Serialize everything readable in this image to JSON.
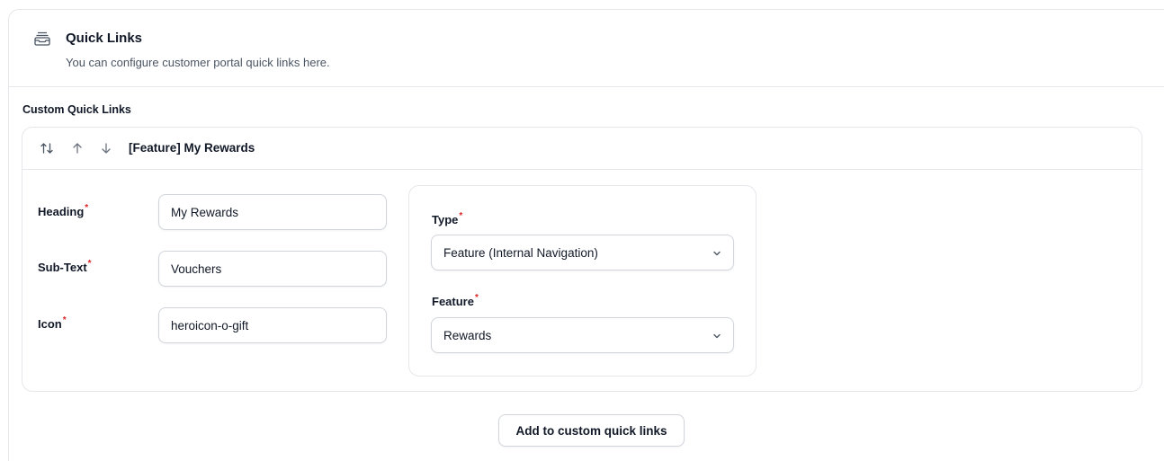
{
  "header": {
    "icon": "inbox-stack-icon",
    "title": "Quick Links",
    "description": "You can configure customer portal quick links here."
  },
  "section": {
    "label": "Custom Quick Links"
  },
  "item": {
    "controls": [
      "reorder-icon",
      "move-up-icon",
      "move-down-icon"
    ],
    "title": "[Feature] My Rewards",
    "fields": {
      "heading": {
        "label": "Heading",
        "value": "My Rewards"
      },
      "subtext": {
        "label": "Sub-Text",
        "value": "Vouchers"
      },
      "icon": {
        "label": "Icon",
        "value": "heroicon-o-gift"
      }
    },
    "type": {
      "label": "Type",
      "value": "Feature (Internal Navigation)"
    },
    "feature": {
      "label": "Feature",
      "value": "Rewards"
    },
    "required_marker": "*"
  },
  "actions": {
    "add_label": "Add to custom quick links"
  },
  "colors": {
    "required": "#dc2626",
    "border": "#e5e7eb",
    "text": "#111827",
    "muted": "#4b5563"
  }
}
